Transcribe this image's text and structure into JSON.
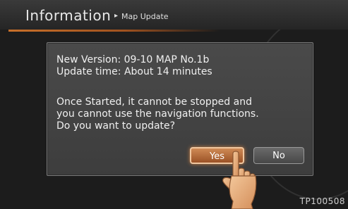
{
  "header": {
    "title": "Information",
    "breadcrumb_arrow": "▸",
    "breadcrumb": "Map Update"
  },
  "dialog": {
    "lines": [
      "New Version:  09-10 MAP No.1b",
      "Update time:  About 14 minutes",
      "Once Started, it cannot be stopped and",
      "you cannot use the navigation functions.",
      "Do you want to update?"
    ],
    "buttons": {
      "yes_label": "Yes",
      "no_label": "No"
    }
  },
  "figure_id": "TP100508",
  "icons": {
    "pointer": "hand-pointer-icon"
  },
  "colors": {
    "accent": "#c8702a",
    "background": "#1c1c1c",
    "dialog": "#444444"
  }
}
